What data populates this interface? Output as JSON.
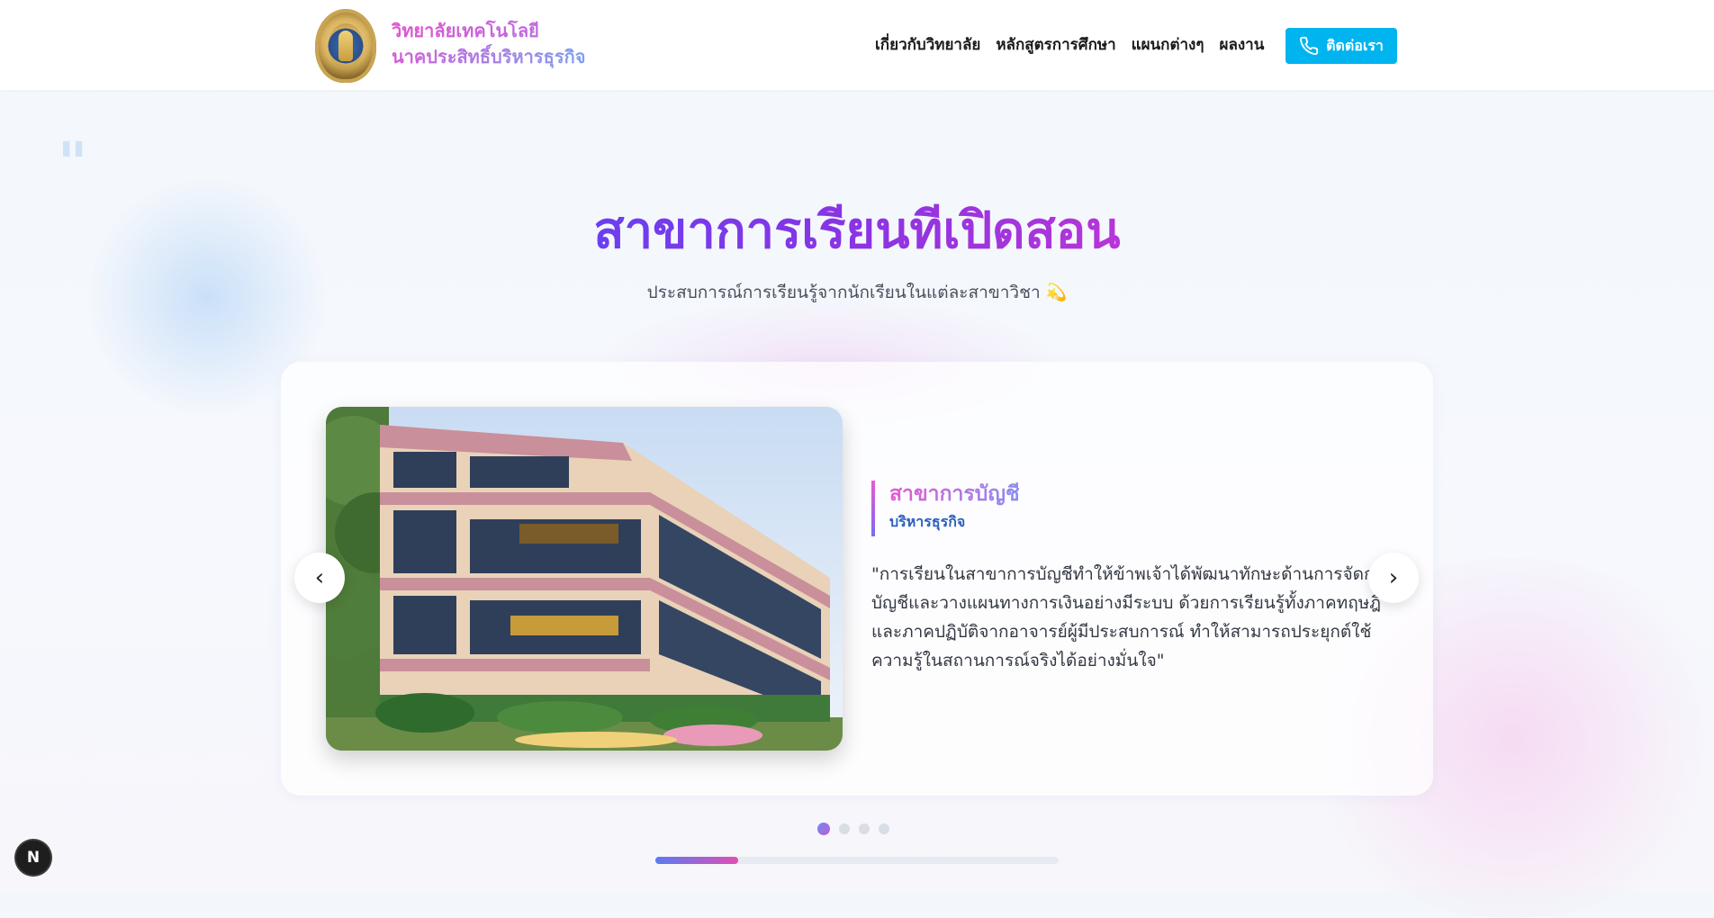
{
  "brand": {
    "line1": "วิทยาลัยเทคโนโลยี",
    "line2": "นาคประสิทธิ์บริหารธุรกิจ",
    "logo_icon": "college-emblem-icon"
  },
  "nav": {
    "items": [
      {
        "label": "เกี่ยวกับวิทยาลัย"
      },
      {
        "label": "หลักสูตรการศึกษา"
      },
      {
        "label": "แผนกต่างๆ"
      },
      {
        "label": "ผลงาน"
      }
    ],
    "contact_label": "ติดต่อเรา",
    "contact_icon": "phone-icon"
  },
  "section": {
    "quote_glyph": "\"",
    "title": "สาขาการเรียนทีเปิดสอน",
    "subtitle": "ประสบการณ์การเรียนรู้จากนักเรียนในแต่ละสาขาวิชา 💫"
  },
  "slide": {
    "major": "สาขาการบัญชี",
    "faculty": "บริหารธุรกิจ",
    "quote": "\"การเรียนในสาขาการบัญชีทำให้ข้าพเจ้าได้พัฒนาทักษะด้านการจัดการบัญชีและวางแผนทางการเงินอย่างมีระบบ ด้วยการเรียนรู้ทั้งภาคทฤษฎีและภาคปฏิบัติจากอาจารย์ผู้มีประสบการณ์ ทำให้สามารถประยุกต์ใช้ความรู้ในสถานการณ์จริงได้อย่างมั่นใจ\"",
    "image": "college-building-photo"
  },
  "carousel": {
    "prev_icon": "chevron-left-icon",
    "next_icon": "chevron-right-icon",
    "prev_glyph": "‹",
    "next_glyph": "›",
    "total_slides": 4,
    "active_index": 0,
    "progress_fraction": 0.25
  },
  "badge": {
    "label": "N"
  },
  "colors": {
    "accent_cyan": "#00b4f0",
    "title_purple": "#7b3ae8",
    "pink": "#e45bd0",
    "faculty_blue": "#2b5fbf"
  }
}
